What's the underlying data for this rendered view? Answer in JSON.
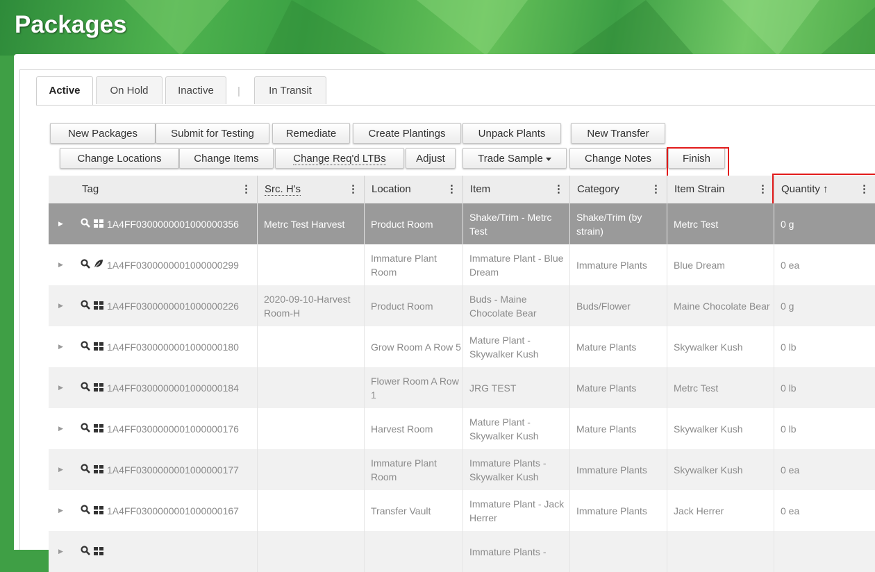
{
  "page_title": "Packages",
  "tabs": [
    {
      "label": "Active",
      "active": true
    },
    {
      "label": "On Hold",
      "active": false
    },
    {
      "label": "Inactive",
      "active": false
    },
    {
      "label": "In Transit",
      "active": false
    }
  ],
  "tab_separator": "|",
  "toolbar_row1": [
    {
      "label": "New Packages"
    },
    {
      "label": "Submit for Testing"
    },
    {
      "label": "Remediate"
    },
    {
      "label": "Create Plantings"
    },
    {
      "label": "Unpack Plants"
    },
    {
      "label": "New Transfer"
    }
  ],
  "toolbar_row2": [
    {
      "label": "Change Locations"
    },
    {
      "label": "Change Items"
    },
    {
      "label": "Change Req'd LTBs"
    },
    {
      "label": "Adjust"
    },
    {
      "label": "Trade Sample"
    },
    {
      "label": "Change Notes"
    },
    {
      "label": "Finish"
    }
  ],
  "columns": [
    {
      "label": "Tag"
    },
    {
      "label": "Src. H's"
    },
    {
      "label": "Location"
    },
    {
      "label": "Item"
    },
    {
      "label": "Category"
    },
    {
      "label": "Item Strain"
    },
    {
      "label": "Quantity"
    }
  ],
  "sort_indicator": "↑",
  "column_menu_glyph": "⋮",
  "highlight_color": "#e21b1b",
  "rows": [
    {
      "tag": "1A4FF0300000001000000356",
      "icon": "barcode-icon",
      "src": "Metrc Test Harvest",
      "location": "Product Room",
      "item": "Shake/Trim - Metrc Test",
      "category": "Shake/Trim (by strain)",
      "strain": "Metrc Test",
      "quantity": "0 g",
      "selected": true
    },
    {
      "tag": "1A4FF0300000001000000299",
      "icon": "leaf-icon",
      "src": "",
      "location": "Immature Plant Room",
      "item": "Immature Plant - Blue Dream",
      "category": "Immature Plants",
      "strain": "Blue Dream",
      "quantity": "0 ea",
      "selected": false
    },
    {
      "tag": "1A4FF0300000001000000226",
      "icon": "barcode-icon",
      "src": "2020-09-10-Harvest Room-H",
      "location": "Product Room",
      "item": "Buds - Maine Chocolate Bear",
      "category": "Buds/Flower",
      "strain": "Maine Chocolate Bear",
      "quantity": "0 g",
      "selected": false
    },
    {
      "tag": "1A4FF0300000001000000180",
      "icon": "barcode-icon",
      "src": "",
      "location": "Grow Room A Row 5",
      "item": "Mature Plant - Skywalker Kush",
      "category": "Mature Plants",
      "strain": "Skywalker Kush",
      "quantity": "0 lb",
      "selected": false
    },
    {
      "tag": "1A4FF0300000001000000184",
      "icon": "barcode-icon",
      "src": "",
      "location": "Flower Room A Row 1",
      "item": "JRG TEST",
      "category": "Mature Plants",
      "strain": "Metrc Test",
      "quantity": "0 lb",
      "selected": false
    },
    {
      "tag": "1A4FF0300000001000000176",
      "icon": "barcode-icon",
      "src": "",
      "location": "Harvest Room",
      "item": "Mature Plant - Skywalker Kush",
      "category": "Mature Plants",
      "strain": "Skywalker Kush",
      "quantity": "0 lb",
      "selected": false
    },
    {
      "tag": "1A4FF0300000001000000177",
      "icon": "barcode-icon",
      "src": "",
      "location": "Immature Plant Room",
      "item": "Immature Plants - Skywalker Kush",
      "category": "Immature Plants",
      "strain": "Skywalker Kush",
      "quantity": "0 ea",
      "selected": false
    },
    {
      "tag": "1A4FF0300000001000000167",
      "icon": "barcode-icon",
      "src": "",
      "location": "Transfer Vault",
      "item": "Immature Plant - Jack Herrer",
      "category": "Immature Plants",
      "strain": "Jack Herrer",
      "quantity": "0 ea",
      "selected": false
    },
    {
      "tag": "",
      "icon": "barcode-icon",
      "src": "",
      "location": "",
      "item": "Immature Plants -",
      "category": "",
      "strain": "",
      "quantity": "",
      "selected": false
    }
  ]
}
